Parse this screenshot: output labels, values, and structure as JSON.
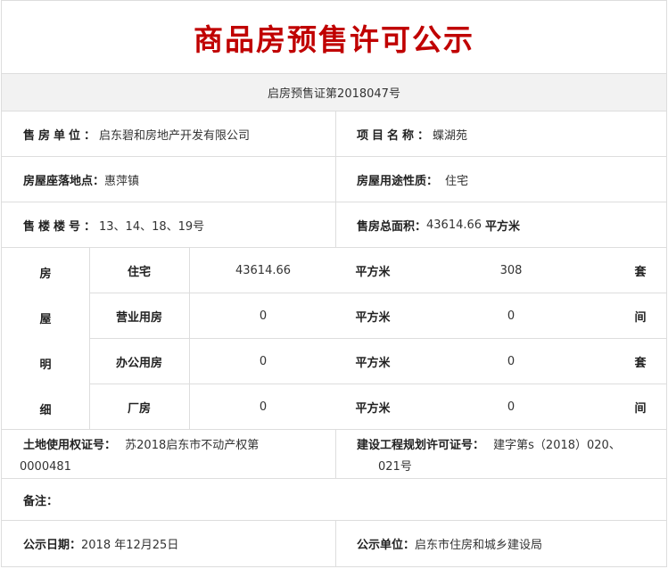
{
  "title": "商品房预售许可公示",
  "permit_no": "启房预售证第2018047号",
  "info": {
    "seller_label": "售房单位：",
    "seller_value": "启东碧和房地产开发有限公司",
    "project_label": "项目名称：",
    "project_value": "蝶湖苑",
    "location_label": "房屋座落地点：",
    "location_value": "惠萍镇",
    "usage_label": "房屋用途性质：",
    "usage_value": "住宅",
    "buildings_label": "售楼楼号：",
    "buildings_value": "13、14、18、19号",
    "total_area_label": "售房总面积：",
    "total_area_value": "43614.66",
    "total_area_unit": "平方米"
  },
  "detail": {
    "side_chars": [
      "房",
      "屋",
      "明",
      "细"
    ],
    "rows": [
      {
        "type": "住宅",
        "area": "43614.66",
        "area_unit": "平方米",
        "count": "308",
        "count_unit": "套"
      },
      {
        "type": "营业用房",
        "area": "0",
        "area_unit": "平方米",
        "count": "0",
        "count_unit": "间"
      },
      {
        "type": "办公用房",
        "area": "0",
        "area_unit": "平方米",
        "count": "0",
        "count_unit": "套"
      },
      {
        "type": "厂房",
        "area": "0",
        "area_unit": "平方米",
        "count": "0",
        "count_unit": "间"
      }
    ]
  },
  "certs": {
    "land_label": "土地使用权证号：",
    "land_value_line1": "苏2018启东市不动产权第",
    "land_value_line2": "0000481",
    "plan_label": "建设工程规划许可证号：",
    "plan_value_line1": "建字第s（2018）020、",
    "plan_value_line2": "021号"
  },
  "remarks_label": "备注：",
  "footer": {
    "date_label": "公示日期：",
    "date_value": "2018 年12月25日",
    "unit_label": "公示单位：",
    "unit_value": "启东市住房和城乡建设局"
  }
}
